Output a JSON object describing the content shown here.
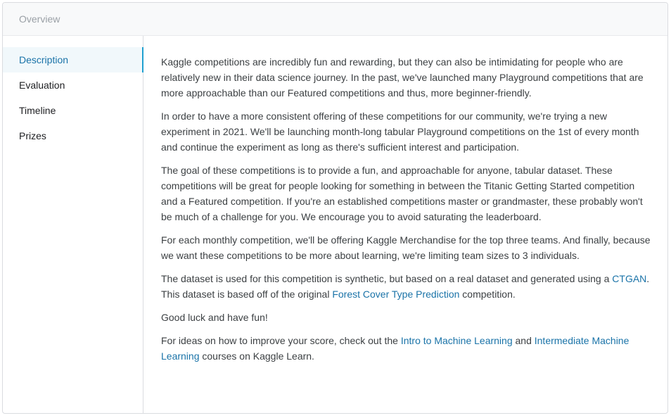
{
  "header": {
    "title": "Overview"
  },
  "sidebar": {
    "items": [
      {
        "label": "Description",
        "active": true
      },
      {
        "label": "Evaluation",
        "active": false
      },
      {
        "label": "Timeline",
        "active": false
      },
      {
        "label": "Prizes",
        "active": false
      }
    ]
  },
  "content": {
    "p1": "Kaggle competitions are incredibly fun and rewarding, but they can also be intimidating for people who are relatively new in their data science journey. In the past, we've launched many Playground competitions that are more approachable than our Featured competitions and thus, more beginner-friendly.",
    "p2": "In order to have a more consistent offering of these competitions for our community, we're trying a new experiment in 2021. We'll be launching month-long tabular Playground competitions on the 1st of every month and continue the experiment as long as there's sufficient interest and participation.",
    "p3": "The goal of these competitions is to provide a fun, and approachable for anyone, tabular dataset. These competitions will be great for people looking for something in between the Titanic Getting Started competition and a Featured competition. If you're an established competitions master or grandmaster, these probably won't be much of a challenge for you. We encourage you to avoid saturating the leaderboard.",
    "p4": "For each monthly competition, we'll be offering Kaggle Merchandise for the top three teams. And finally, because we want these competitions to be more about learning, we're limiting team sizes to 3 individuals.",
    "p5": {
      "text_before": "The dataset is used for this competition is synthetic, but based on a real dataset and generated using a ",
      "link1": "CTGAN",
      "text_middle": ". This dataset is based off of the original ",
      "link2": "Forest Cover Type Prediction",
      "text_after": " competition."
    },
    "p6": "Good luck and have fun!",
    "p7": {
      "text_before": "For ideas on how to improve your score, check out the ",
      "link1": "Intro to Machine Learning",
      "text_middle": " and ",
      "link2": "Intermediate Machine Learning",
      "text_after": " courses on Kaggle Learn."
    }
  },
  "colors": {
    "accent": "#1a73a8",
    "active_indicator": "#20a0d0",
    "active_bg": "#f1f8fb",
    "header_bg": "#f8f9fa",
    "border": "#dadce0"
  }
}
